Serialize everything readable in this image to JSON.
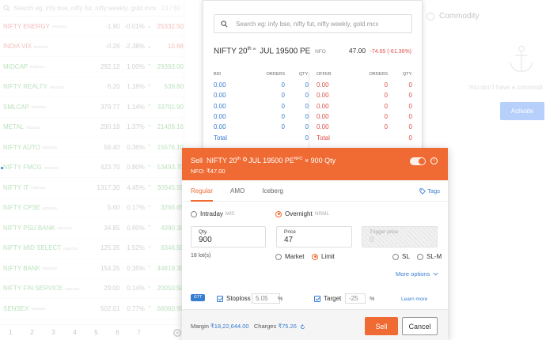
{
  "watchlist": {
    "search_placeholder": "Search eg: infy bse, nifty fut, nifty weekly, gold mcx",
    "count": "13 / 50",
    "items": [
      {
        "name": "NIFTY ENERGY",
        "exch": "INDICES",
        "change": "-1.90",
        "pct": "-0.01%",
        "arrow": "⌄",
        "price": "25332.50",
        "dir": "dn"
      },
      {
        "name": "INDIA VIX",
        "exch": "INDICES",
        "change": "-0.26",
        "pct": "-2.38%",
        "arrow": "⌄",
        "price": "10.68",
        "dir": "dn"
      },
      {
        "name": "MIDCAP",
        "exch": "INDICES",
        "change": "292.12",
        "pct": "1.00%",
        "arrow": "⌃",
        "price": "29393.00",
        "dir": "up"
      },
      {
        "name": "NIFTY REALTY",
        "exch": "INDICES",
        "change": "6.20",
        "pct": "1.16%",
        "arrow": "⌃",
        "price": "539.80",
        "dir": "up"
      },
      {
        "name": "SMLCAP",
        "exch": "INDICES",
        "change": "379.77",
        "pct": "1.14%",
        "arrow": "⌃",
        "price": "33701.90",
        "dir": "up"
      },
      {
        "name": "METAL",
        "exch": "INDICES",
        "change": "290.19",
        "pct": "1.37%",
        "arrow": "⌃",
        "price": "21409.16",
        "dir": "up"
      },
      {
        "name": "NIFTY AUTO",
        "exch": "INDICES",
        "change": "56.40",
        "pct": "0.36%",
        "arrow": "⌃",
        "price": "15576.10",
        "dir": "up"
      },
      {
        "name": "NIFTY FMCG",
        "exch": "INDICES",
        "change": "423.70",
        "pct": "0.80%",
        "arrow": "⌃",
        "price": "53493.70",
        "dir": "up"
      },
      {
        "name": "NIFTY IT",
        "exch": "INDICES",
        "change": "1317.30",
        "pct": "4.45%",
        "arrow": "⌃",
        "price": "30945.50",
        "dir": "up"
      },
      {
        "name": "NIFTY CPSE",
        "exch": "INDICES",
        "change": "5.60",
        "pct": "0.17%",
        "arrow": "⌃",
        "price": "3266.65",
        "dir": "up"
      },
      {
        "name": "NIFTY PSU BANK",
        "exch": "INDICES",
        "change": "34.85",
        "pct": "0.80%",
        "arrow": "⌃",
        "price": "4390.30",
        "dir": "up"
      },
      {
        "name": "NIFTY MID SELECT",
        "exch": "INDICES",
        "change": "125.35",
        "pct": "1.52%",
        "arrow": "⌃",
        "price": "8346.50",
        "dir": "up"
      },
      {
        "name": "NIFTY BANK",
        "exch": "INDICES",
        "change": "154.25",
        "pct": "0.35%",
        "arrow": "⌃",
        "price": "44819.30",
        "dir": "up"
      },
      {
        "name": "NIFTY FIN SERVICE",
        "exch": "INDICES",
        "change": "29.00",
        "pct": "0.14%",
        "arrow": "⌃",
        "price": "20050.50",
        "dir": "up"
      },
      {
        "name": "SENSEX",
        "exch": "INDICES",
        "change": "502.01",
        "pct": "0.77%",
        "arrow": "⌃",
        "price": "66060.90",
        "dir": "up"
      }
    ],
    "pages": [
      "1",
      "2",
      "3",
      "4",
      "5",
      "6",
      "7"
    ]
  },
  "right_panel": {
    "commodity_label": "Commodity",
    "empty_text": "You don't have a commodi",
    "activate_label": "Activate"
  },
  "depth": {
    "search_placeholder": "Search eg: infy bse, nifty fut, nifty weekly, gold mcx",
    "title_main": "NIFTY 20",
    "title_sup": "th",
    "title_sup2": "W",
    "title_rest": "JUL 19500 PE",
    "title_exch": "NFO",
    "ltp": "47.00",
    "change": "-74.65 (-61.36%)",
    "headers": [
      "BID",
      "ORDERS",
      "QTY.",
      "OFFER",
      "ORDERS",
      "QTY."
    ],
    "rows": [
      [
        "0.00",
        "0",
        "0",
        "0.00",
        "0",
        "0"
      ],
      [
        "0.00",
        "0",
        "0",
        "0.00",
        "0",
        "0"
      ],
      [
        "0.00",
        "0",
        "0",
        "0.00",
        "0",
        "0"
      ],
      [
        "0.00",
        "0",
        "0",
        "0.00",
        "0",
        "0"
      ],
      [
        "0.00",
        "0",
        "0",
        "0.00",
        "0",
        "0"
      ]
    ],
    "total": [
      "Total",
      "",
      "0",
      "Total",
      "",
      "0"
    ]
  },
  "order": {
    "action": "Sell",
    "symbol_main": "NIFTY 20",
    "symbol_sup": "th",
    "symbol_rest": "JUL 19500 PE",
    "symbol_exch": "NFO",
    "qty_text": "× 900 Qty",
    "subline": "NFO: ₹47.00",
    "info_glyph": "i",
    "tabs": [
      "Regular",
      "AMO",
      "Iceberg"
    ],
    "tags_label": "Tags",
    "product": {
      "intraday": "Intraday",
      "intraday_sub": "MIS",
      "overnight": "Overnight",
      "overnight_sub": "NRML"
    },
    "qty": {
      "label": "Qty.",
      "value": "900"
    },
    "price": {
      "label": "Price",
      "value": "47"
    },
    "trigger": {
      "label": "Trigger price",
      "value": "0"
    },
    "lots": "18 lot(s)",
    "types": {
      "market": "Market",
      "limit": "Limit",
      "sl": "SL",
      "slm": "SL-M"
    },
    "more_options": "More options",
    "gtt_badge": "GTT",
    "stoploss": {
      "label": "Stoploss",
      "value": "5.05",
      "unit": "%"
    },
    "target": {
      "label": "Target",
      "value": "-25",
      "unit": "%"
    },
    "learn_more": "Learn more",
    "margin_label": "Margin",
    "margin_value": "₹18,22,644.00",
    "charges_label": "Charges",
    "charges_value": "₹75.26",
    "sell_label": "Sell",
    "cancel_label": "Cancel"
  },
  "colors": {
    "accent": "#ef6b33",
    "blue": "#387ed1",
    "red": "#df514c",
    "green": "#4caf50"
  }
}
